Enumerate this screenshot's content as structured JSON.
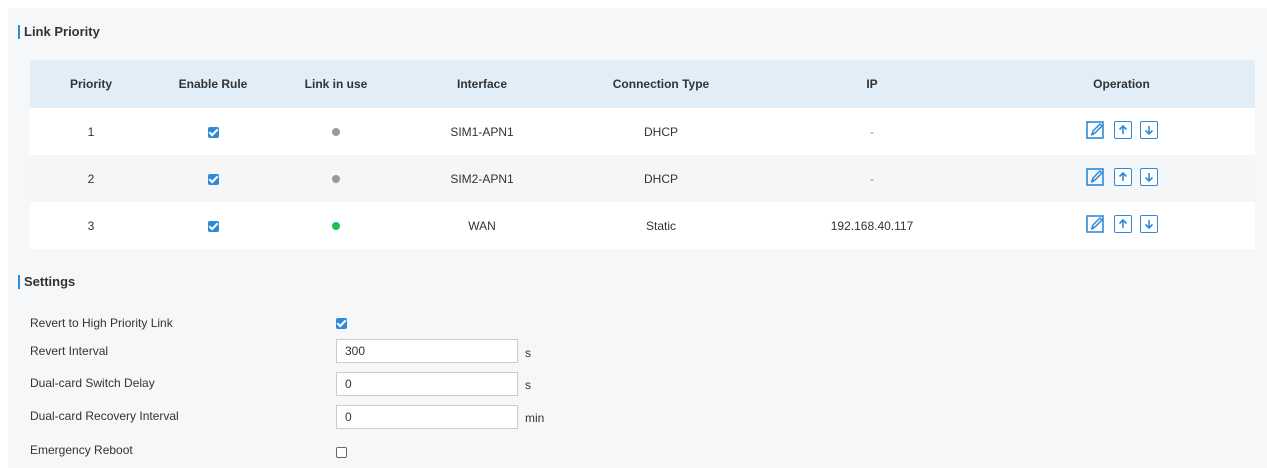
{
  "link_priority": {
    "title": "Link Priority",
    "columns": [
      "Priority",
      "Enable Rule",
      "Link in use",
      "Interface",
      "Connection Type",
      "IP",
      "Operation"
    ],
    "rows": [
      {
        "priority": "1",
        "enabled": true,
        "link_status": "gray",
        "interface": "SIM1-APN1",
        "connection_type": "DHCP",
        "ip": "-"
      },
      {
        "priority": "2",
        "enabled": true,
        "link_status": "gray",
        "interface": "SIM2-APN1",
        "connection_type": "DHCP",
        "ip": "-"
      },
      {
        "priority": "3",
        "enabled": true,
        "link_status": "green",
        "interface": "WAN",
        "connection_type": "Static",
        "ip": "192.168.40.117"
      }
    ]
  },
  "settings": {
    "title": "Settings",
    "revert_label": "Revert to High Priority Link",
    "revert_checked": true,
    "revert_interval_label": "Revert Interval",
    "revert_interval_value": "300",
    "revert_interval_unit": "s",
    "switch_delay_label": "Dual-card Switch Delay",
    "switch_delay_value": "0",
    "switch_delay_unit": "s",
    "recovery_label": "Dual-card Recovery Interval",
    "recovery_value": "0",
    "recovery_unit": "min",
    "emergency_label": "Emergency Reboot",
    "emergency_checked": false
  },
  "colors": {
    "accent": "#2e8ad8",
    "header_bg": "#e1eef8",
    "status_gray": "#999999",
    "status_green": "#1cc24d"
  },
  "icons": {
    "edit": "edit-icon",
    "up": "arrow-up-icon",
    "down": "arrow-down-icon"
  }
}
